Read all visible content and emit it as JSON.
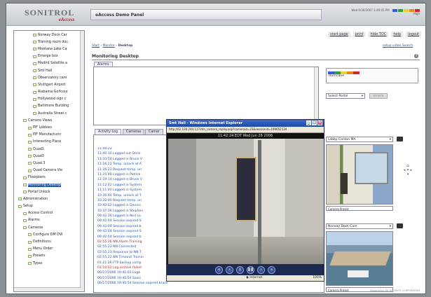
{
  "header": {
    "logo_brand": "SONITROL",
    "logo_sub": "eAccess",
    "app_title": "eAccess Demo Panel",
    "datetime": "Wed 6/30/2007 1:46:05 PM",
    "status_level": "High"
  },
  "top_nav": [
    "start page",
    "print",
    "hide TOC",
    "help",
    "logout"
  ],
  "sidebar": {
    "items": [
      {
        "label": "Norway Dock Car",
        "indent": 3,
        "sel": false
      },
      {
        "label": "Training room doc",
        "indent": 3,
        "sel": false
      },
      {
        "label": "Montana Lake Ca",
        "indent": 3,
        "sel": false
      },
      {
        "label": "Emerge box",
        "indent": 3,
        "sel": false
      },
      {
        "label": "Madrid Satellite a",
        "indent": 3,
        "sel": false
      },
      {
        "label": "Smt Hall",
        "indent": 3,
        "sel": false
      },
      {
        "label": "Observatory cam",
        "indent": 3,
        "sel": false
      },
      {
        "label": "Stuttgart Airport",
        "indent": 3,
        "sel": false
      },
      {
        "label": "Alabama Golfcour",
        "indent": 3,
        "sel": false
      },
      {
        "label": "Hollywood sign c",
        "indent": 3,
        "sel": false
      },
      {
        "label": "Baltimore Building",
        "indent": 3,
        "sel": false
      },
      {
        "label": "Australia Street c",
        "indent": 3,
        "sel": false
      },
      {
        "label": "Camera Views",
        "indent": 1,
        "sel": false
      },
      {
        "label": "PIF Lobbies",
        "indent": 2,
        "sel": false
      },
      {
        "label": "PIF Manufacturin",
        "indent": 2,
        "sel": false
      },
      {
        "label": "Interesting Place",
        "indent": 2,
        "sel": false
      },
      {
        "label": "Quad2",
        "indent": 2,
        "sel": false
      },
      {
        "label": "Quad3",
        "indent": 2,
        "sel": false
      },
      {
        "label": "Quad 3",
        "indent": 2,
        "sel": false
      },
      {
        "label": "Quad Camera Vie",
        "indent": 2,
        "sel": false
      },
      {
        "label": "Floorplans",
        "indent": 1,
        "sel": false
      },
      {
        "label": "Monitoring Desktop",
        "indent": 1,
        "sel": true
      },
      {
        "label": "Portal Unlock",
        "indent": 1,
        "sel": false
      },
      {
        "label": "Administration",
        "indent": 0,
        "sel": false
      },
      {
        "label": "Setup",
        "indent": 0,
        "sel": false
      },
      {
        "label": "Access Control",
        "indent": 1,
        "sel": false
      },
      {
        "label": "Alarms",
        "indent": 1,
        "sel": false
      },
      {
        "label": "Cameras",
        "indent": 1,
        "sel": false
      },
      {
        "label": "Configure DM DVI",
        "indent": 2,
        "sel": false
      },
      {
        "label": "Definitions",
        "indent": 2,
        "sel": false
      },
      {
        "label": "Menu Order",
        "indent": 2,
        "sel": false
      },
      {
        "label": "Presets",
        "indent": 2,
        "sel": false
      },
      {
        "label": "Types",
        "indent": 2,
        "sel": false
      }
    ]
  },
  "breadcrumb": {
    "start": "Start",
    "monitor": "Monitor",
    "current": "Desktop"
  },
  "crumb_right": "setup video  Search",
  "page_title": "Monitoring Desktop",
  "alarms_tab": "Alarms",
  "hurricane_label": "Hurricane",
  "status_colors": [
    "#3b5bd6",
    "#2e9e3e",
    "#e6d23a",
    "#e58a22",
    "#d22a2a"
  ],
  "portal_select": "Select Portal",
  "unlock_btn": "Unlock",
  "log_tabs": {
    "activity": "Activity Log",
    "cameras": "Cameras",
    "other": "Camer"
  },
  "log_lines": [
    {
      "text": "11:40:22",
      "red": false
    },
    {
      "text": "11:40:30 Logged out Denn",
      "red": false
    },
    {
      "text": "11:33:56 Logged in Bruce V",
      "red": false
    },
    {
      "text": "11:26:22 Temp. unlock at A",
      "red": false
    },
    {
      "text": "11:26:22 Request temp. un",
      "red": false
    },
    {
      "text": "11:25:48 Logged in Patrick",
      "red": false
    },
    {
      "text": "11:19:14 Logged in Bruce V",
      "red": false
    },
    {
      "text": "11:12:42 Logged in System",
      "red": false
    },
    {
      "text": "11:11:40 Logged in System",
      "red": false
    },
    {
      "text": "10:30:40 Temp. unlock at T",
      "red": false
    },
    {
      "text": "10:30:40 Request temp. un",
      "red": false
    },
    {
      "text": "10:40:02 Logged in Dennis",
      "red": false
    },
    {
      "text": "10:37:36 Logged in Stephen",
      "red": false
    },
    {
      "text": "09:42:16 Logged in Neil Lo",
      "red": false
    },
    {
      "text": "09:42:04 Session expired S",
      "red": false
    },
    {
      "text": "09:42:04 Session expired b",
      "red": false
    },
    {
      "text": "09:42:04 Session expired S",
      "red": false
    },
    {
      "text": "09:42:04 Session expired b",
      "red": false
    },
    {
      "text": "02:55:26 NN Alarm Training",
      "red": true
    },
    {
      "text": "02:55:23 NN Connected",
      "red": false
    },
    {
      "text": "02:55:23 Response to NN T",
      "red": false
    },
    {
      "text": "02:55:22 NN Timeout Trainin",
      "red": false
    },
    {
      "text": "01:21:26 FTP backup comp",
      "red": false
    },
    {
      "text": "01:10:02 Log archive failed",
      "red": true
    },
    {
      "text": "06/27/2006 19:41:03 Logo",
      "red": false
    },
    {
      "text": "06/27/2006 19:40:54 Sessi",
      "red": false
    },
    {
      "text": "06/27/2006 19:40:54 Session expired bruce (attendion from 62.126.244.114",
      "red": false
    }
  ],
  "ie_window": {
    "title": "Smt Hall - Windows Internet Explorer",
    "address": "http://62.130.244.117/dm_camera_replay.asp?cameraid=23&sessionid=199652134",
    "timestamp": "11:42:24 EDT Wed Jun 28 2006",
    "status_zone": "Internet",
    "zoom": "100%"
  },
  "cam1": {
    "name": "Lobby  Canton  MA",
    "preset": "Camera Preset"
  },
  "cam2": {
    "name": "Norway Dock Cam",
    "preset": "Camera Preset"
  },
  "footer": "Powered by RE SECURITY CORPORATION"
}
